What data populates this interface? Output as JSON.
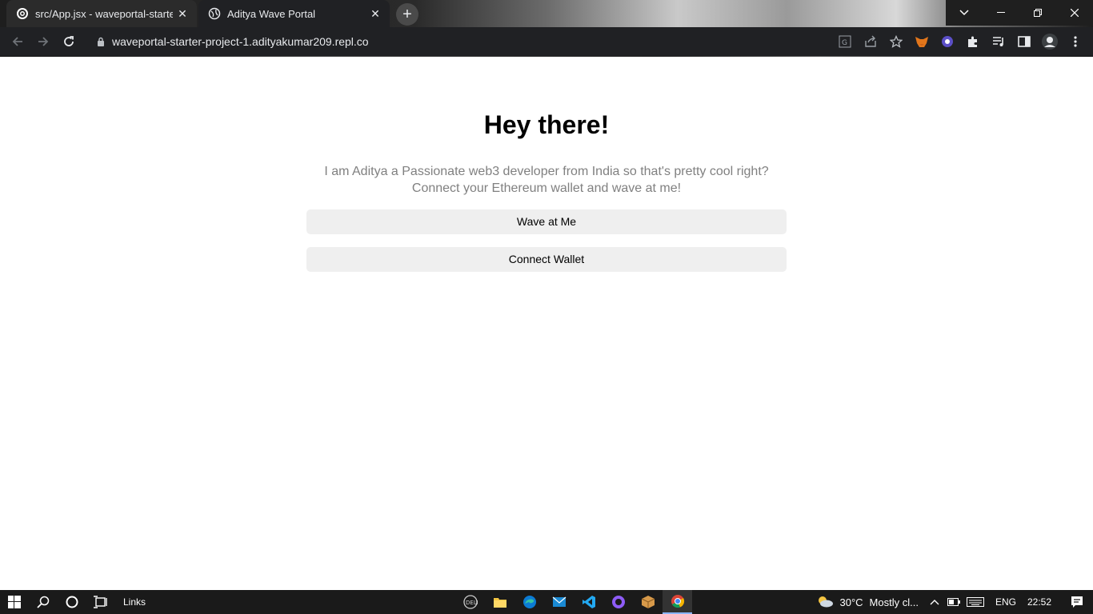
{
  "browser": {
    "tabs": [
      {
        "title": "src/App.jsx - waveportal-starter-p",
        "icon": "replit-icon"
      },
      {
        "title": "Aditya Wave Portal",
        "icon": "globe-icon"
      }
    ],
    "new_tab_label": "+",
    "url": "waveportal-starter-project-1.adityakumar209.repl.co"
  },
  "page": {
    "heading": "Hey there!",
    "bio_line1": "I am Aditya a Passionate web3 developer from India so that's pretty cool right?",
    "bio_line2": "Connect your Ethereum wallet and wave at me!",
    "wave_button": "Wave at Me",
    "connect_button": "Connect Wallet"
  },
  "taskbar": {
    "links_label": "Links",
    "weather": "30°C",
    "weather_desc": "Mostly cl...",
    "language": "ENG",
    "time": "22:52"
  }
}
